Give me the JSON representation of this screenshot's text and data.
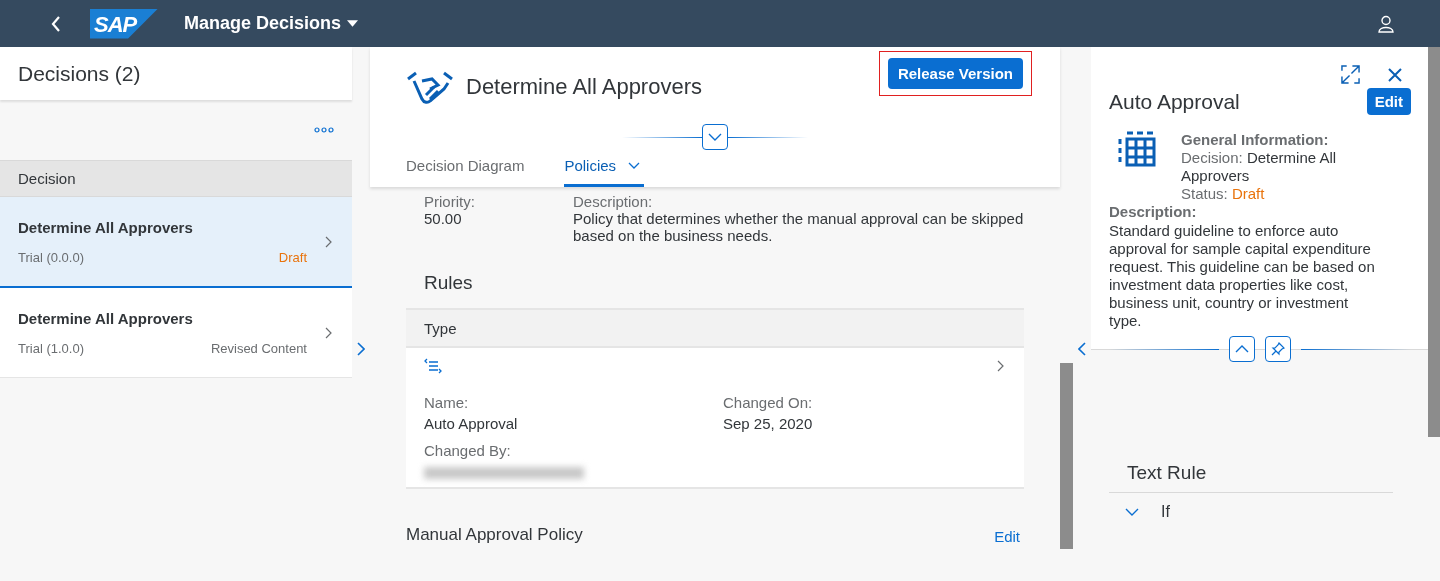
{
  "shell": {
    "logo": "SAP",
    "title": "Manage Decisions"
  },
  "list": {
    "title": "Decisions (2)",
    "column": "Decision",
    "items": [
      {
        "name": "Determine All Approvers",
        "version": "Trial (0.0.0)",
        "status": "Draft",
        "color": "#e9730c",
        "selected": true
      },
      {
        "name": "Determine All Approvers",
        "version": "Trial (1.0.0)",
        "status": "Revised Content",
        "color": "#6a6d70",
        "selected": false
      }
    ]
  },
  "object": {
    "title": "Determine All Approvers",
    "action": "Release Version",
    "tabs": [
      {
        "label": "Decision Diagram",
        "selected": false
      },
      {
        "label": "Policies",
        "selected": true
      }
    ],
    "fields": [
      {
        "label": "Priority:",
        "value": "50.00"
      },
      {
        "label": "Description:",
        "value": "Policy that determines whether the manual approval can be skipped based on the business needs."
      }
    ],
    "rules": {
      "title": "Rules",
      "column": "Type",
      "row": {
        "fields": [
          {
            "label": "Name:",
            "value": "Auto Approval"
          },
          {
            "label": "Changed On:",
            "value": "Sep 25, 2020"
          },
          {
            "label": "Changed By:",
            "redacted": true
          }
        ]
      }
    },
    "next_section": {
      "title": "Manual Approval Policy",
      "action": "Edit"
    }
  },
  "detail": {
    "title": "Auto Approval",
    "action": "Edit",
    "info_title": "General Information:",
    "decision_label": "Decision:",
    "decision": "Determine All Approvers",
    "status_label": "Status:",
    "status": {
      "text": "Draft",
      "color": "#e9730c"
    },
    "description_label": "Description:",
    "description": "Standard guideline to enforce auto approval for sample capital expenditure request. This guideline can be based on investment data properties like cost, business unit, country or investment type.",
    "section": {
      "title": "Text Rule",
      "items": [
        {
          "label": "If",
          "expanded": true
        }
      ]
    }
  }
}
